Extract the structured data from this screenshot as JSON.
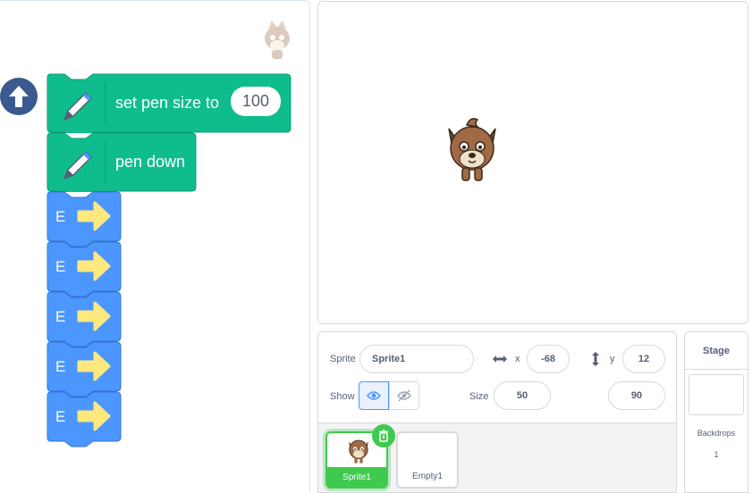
{
  "blocks": {
    "set_pen_size_label": "set pen size to",
    "set_pen_size_value": "100",
    "pen_down_label": "pen down",
    "e_blocks": [
      "E",
      "E",
      "E",
      "E",
      "E"
    ]
  },
  "sprite_info": {
    "sprite_label": "Sprite",
    "sprite_name": "Sprite1",
    "x_label": "x",
    "x_value": "-68",
    "y_label": "y",
    "y_value": "12",
    "show_label": "Show",
    "size_label": "Size",
    "size_value": "50",
    "direction_value": "90"
  },
  "sprites": [
    {
      "name": "Sprite1",
      "selected": true
    },
    {
      "name": "Empty1",
      "selected": false
    }
  ],
  "stage_pane": {
    "title": "Stage",
    "backdrops_label": "Backdrops",
    "backdrops_count": "1"
  },
  "colors": {
    "pen_green": "#0fbd8c",
    "pen_green_dark": "#0b9a72",
    "motion_blue": "#4c97ff",
    "motion_blue_dark": "#3373cc",
    "arrow_yellow": "#ffe97f",
    "selected_green": "#3fc94e",
    "go_button": "#3a5a8f"
  },
  "icons": {
    "go": "arrow-up-circle-icon",
    "pen": "pen-extension-icon",
    "arrow": "right-arrow-icon",
    "delete": "trash-icon",
    "show": "eye-icon",
    "hide": "eye-slash-icon"
  }
}
